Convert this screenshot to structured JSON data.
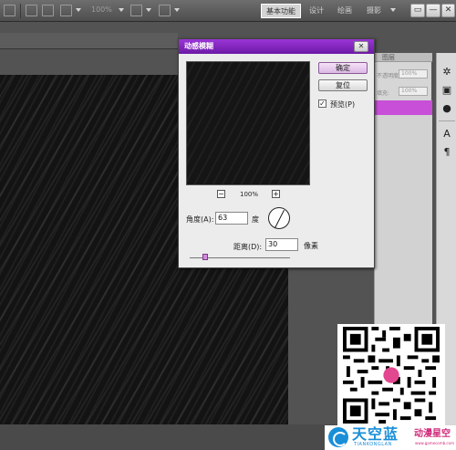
{
  "toolbar": {
    "zoom": "100%",
    "workspaces": [
      "基本功能",
      "设计",
      "绘画",
      "摄影"
    ],
    "window_buttons": [
      "▭",
      "—",
      "▢",
      "✕"
    ]
  },
  "panel": {
    "tab": "图层",
    "opacity_label": "不透明度:",
    "opacity_value": "100%",
    "fill_label": "填充:",
    "fill_value": "100%"
  },
  "dialog": {
    "title": "动感模糊",
    "close": "✕",
    "ok_label": "确定",
    "reset_label": "复位",
    "preview_label": "预览(P)",
    "preview_checked": true,
    "zoom_minus": "−",
    "zoom_plus": "+",
    "zoom_value": "100%",
    "angle_label": "角度(A):",
    "angle_value": "63",
    "angle_unit": "度",
    "angle_degrees": 63,
    "distance_label": "距离(D):",
    "distance_value": "30",
    "distance_unit": "像素"
  },
  "watermark": {
    "logo_cn": "天空蓝",
    "logo_en": "TIANKONGLAN",
    "tag": "动漫星空",
    "tagline": "www.gamecomb.com"
  },
  "colors": {
    "accent": "#c84fd7",
    "title_bar": "#8a2bc8",
    "logo": "#1a8fd8"
  }
}
